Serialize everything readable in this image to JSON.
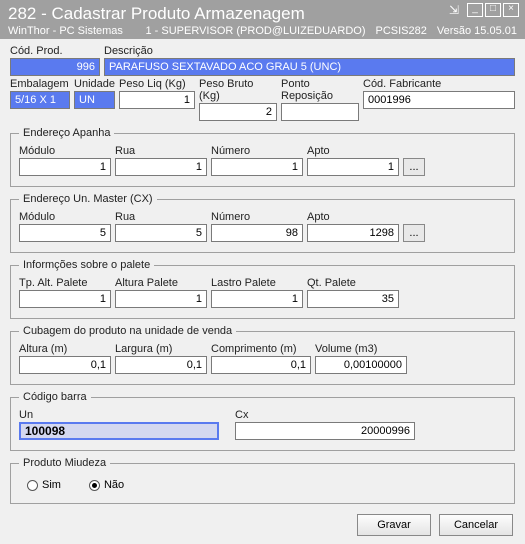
{
  "window": {
    "title_code": "282",
    "title_text": "Cadastrar Produto Armazenagem",
    "app": "WinThor - PC Sistemas",
    "user_line": "1 - SUPERVISOR (PROD@LUIZEDUARDO)",
    "screen_code": "PCSIS282",
    "version": "Versão 15.05.01"
  },
  "top": {
    "cod_prod_label": "Cód. Prod.",
    "cod_prod": "996",
    "descricao_label": "Descrição",
    "descricao": "PARAFUSO SEXTAVADO ACO GRAU 5 (UNC)",
    "embalagem_label": "Embalagem",
    "embalagem": "5/16 X 1",
    "unidade_label": "Unidade",
    "unidade": "UN",
    "peso_liq_label": "Peso Liq (Kg)",
    "peso_liq": "1",
    "peso_bruto_label": "Peso Bruto (Kg)",
    "peso_bruto": "2",
    "ponto_rep_label": "Ponto Reposição",
    "ponto_rep": "",
    "cod_fab_label": "Cód. Fabricante",
    "cod_fab": "0001996"
  },
  "apanha": {
    "legend": "Endereço Apanha",
    "modulo_label": "Módulo",
    "modulo": "1",
    "rua_label": "Rua",
    "rua": "1",
    "numero_label": "Número",
    "numero": "1",
    "apto_label": "Apto",
    "apto": "1",
    "btn": "..."
  },
  "master": {
    "legend": "Endereço Un. Master (CX)",
    "modulo_label": "Módulo",
    "modulo": "5",
    "rua_label": "Rua",
    "rua": "5",
    "numero_label": "Número",
    "numero": "98",
    "apto_label": "Apto",
    "apto": "1298",
    "btn": "..."
  },
  "palete": {
    "legend": "Informções sobre o palete",
    "tp_alt_label": "Tp. Alt. Palete",
    "tp_alt": "1",
    "altura_label": "Altura Palete",
    "altura": "1",
    "lastro_label": "Lastro Palete",
    "lastro": "1",
    "qt_label": "Qt. Palete",
    "qt": "35"
  },
  "cubagem": {
    "legend": "Cubagem do produto na unidade de venda",
    "altura_label": "Altura (m)",
    "altura": "0,1",
    "largura_label": "Largura (m)",
    "largura": "0,1",
    "comp_label": "Comprimento (m)",
    "comp": "0,1",
    "vol_label": "Volume (m3)",
    "vol": "0,00100000"
  },
  "barcode": {
    "legend": "Código barra",
    "un_label": "Un",
    "un": "100098",
    "cx_label": "Cx",
    "cx": "20000996"
  },
  "miudeza": {
    "legend": "Produto Miudeza",
    "sim": "Sim",
    "nao": "Não",
    "selected": "nao"
  },
  "actions": {
    "gravar": "Gravar",
    "cancelar": "Cancelar"
  }
}
